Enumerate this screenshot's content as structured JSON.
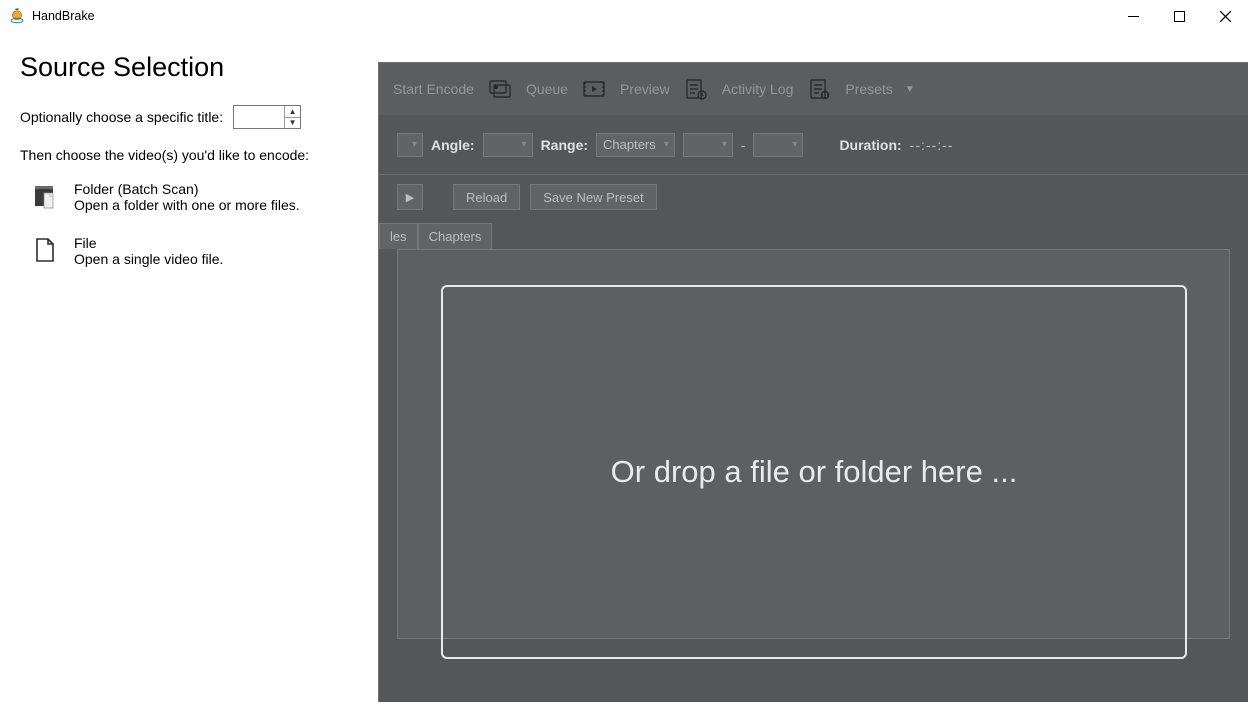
{
  "window": {
    "title": "HandBrake"
  },
  "toolbar": {
    "start_encode": "Start Encode",
    "queue": "Queue",
    "preview": "Preview",
    "activity_log": "Activity Log",
    "presets": "Presets"
  },
  "source_controls": {
    "angle_label": "Angle:",
    "range_label": "Range:",
    "range_mode": "Chapters",
    "range_sep": "-",
    "duration_label": "Duration:",
    "duration_value": "--:--:--"
  },
  "preset_row": {
    "reload": "Reload",
    "save_new": "Save New Preset"
  },
  "tabs": {
    "subtitles": "les",
    "chapters": "Chapters"
  },
  "dropzone": {
    "text": "Or drop a file or folder here ..."
  },
  "source_panel": {
    "heading": "Source Selection",
    "title_label": "Optionally choose a specific title:",
    "choose_hint": "Then choose the video(s) you'd like to encode:",
    "folder_title": "Folder (Batch Scan)",
    "folder_sub": "Open a folder with one or more files.",
    "file_title": "File",
    "file_sub": "Open a single video file."
  }
}
